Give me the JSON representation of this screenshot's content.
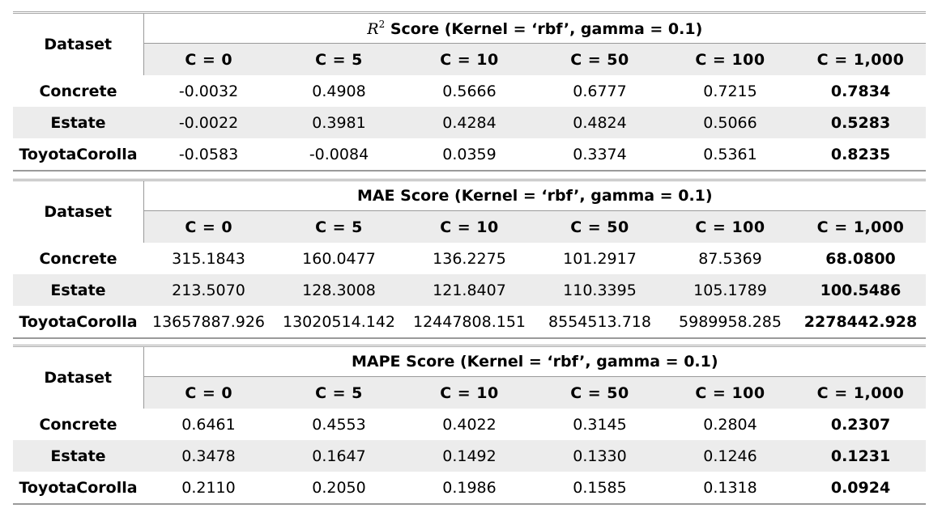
{
  "tables": [
    {
      "metric_symbol": "R",
      "metric_superscript": "2",
      "title": " Score (Kernel = ‘rbf’, gamma = 0.1)",
      "dataset_header": "Dataset",
      "columns": [
        "C = 0",
        "C = 5",
        "C = 10",
        "C = 50",
        "C = 100",
        "C = 1,000"
      ],
      "rows": [
        {
          "dataset": "Concrete",
          "values": [
            "-0.0032",
            "0.4908",
            "0.5666",
            "0.6777",
            "0.7215",
            "0.7834"
          ]
        },
        {
          "dataset": "Estate",
          "values": [
            "-0.0022",
            "0.3981",
            "0.4284",
            "0.4824",
            "0.5066",
            "0.5283"
          ]
        },
        {
          "dataset": "ToyotaCorolla",
          "values": [
            "-0.0583",
            "-0.0084",
            "0.0359",
            "0.3374",
            "0.5361",
            "0.8235"
          ]
        }
      ]
    },
    {
      "title": "MAE Score (Kernel = ‘rbf’, gamma = 0.1)",
      "dataset_header": "Dataset",
      "columns": [
        "C = 0",
        "C = 5",
        "C = 10",
        "C = 50",
        "C = 100",
        "C = 1,000"
      ],
      "rows": [
        {
          "dataset": "Concrete",
          "values": [
            "315.1843",
            "160.0477",
            "136.2275",
            "101.2917",
            "87.5369",
            "68.0800"
          ]
        },
        {
          "dataset": "Estate",
          "values": [
            "213.5070",
            "128.3008",
            "121.8407",
            "110.3395",
            "105.1789",
            "100.5486"
          ]
        },
        {
          "dataset": "ToyotaCorolla",
          "values": [
            "13657887.926",
            "13020514.142",
            "12447808.151",
            "8554513.718",
            "5989958.285",
            "2278442.928"
          ]
        }
      ]
    },
    {
      "title": "MAPE Score (Kernel = ‘rbf’, gamma = 0.1)",
      "dataset_header": "Dataset",
      "columns": [
        "C = 0",
        "C = 5",
        "C = 10",
        "C = 50",
        "C = 100",
        "C = 1,000"
      ],
      "rows": [
        {
          "dataset": "Concrete",
          "values": [
            "0.6461",
            "0.4553",
            "0.4022",
            "0.3145",
            "0.2804",
            "0.2307"
          ]
        },
        {
          "dataset": "Estate",
          "values": [
            "0.3478",
            "0.1647",
            "0.1492",
            "0.1330",
            "0.1246",
            "0.1231"
          ]
        },
        {
          "dataset": "ToyotaCorolla",
          "values": [
            "0.2110",
            "0.2050",
            "0.1986",
            "0.1585",
            "0.1318",
            "0.0924"
          ]
        }
      ]
    }
  ],
  "colors": {
    "shade": "#ececec",
    "rule": "#9a9a9a"
  }
}
